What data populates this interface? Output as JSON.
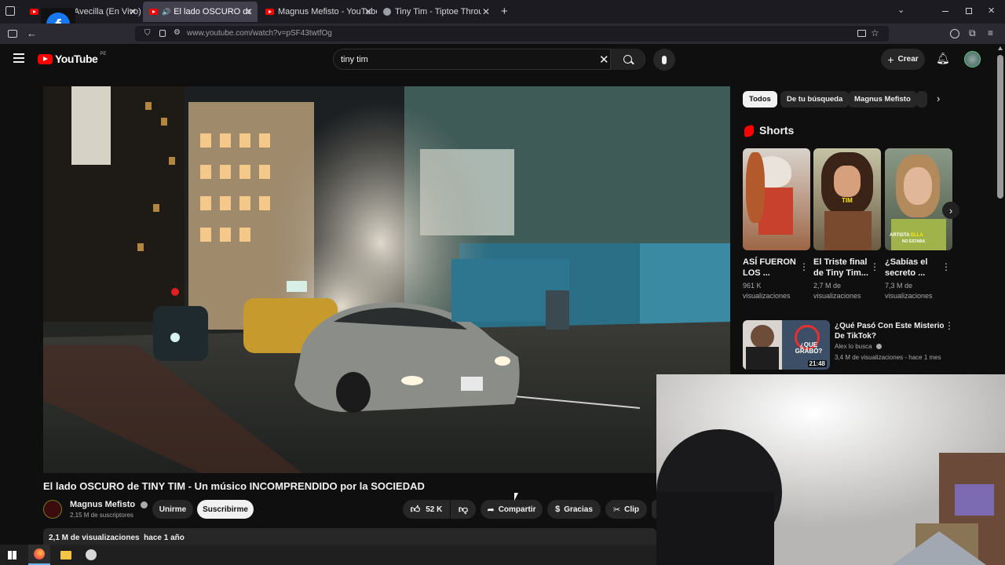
{
  "browser": {
    "tabs": [
      {
        "title": "Avecilla (En Vivo)"
      },
      {
        "title": "El lado OSCURO de TINY TIM"
      },
      {
        "title": "Magnus Mefisto - YouTube"
      },
      {
        "title": "Tiny Tim - Tiptoe Through the T"
      }
    ],
    "url": "www.youtube.com/watch?v=pSF43twtfOg"
  },
  "youtube": {
    "logo_text": "YouTube",
    "region": "PE",
    "search_value": "tiny tim",
    "create_label": "Crear"
  },
  "video": {
    "title": "El lado OSCURO de TINY TIM - Un músico INCOMPRENDIDO por la SOCIEDAD",
    "channel": "Magnus Mefisto",
    "subscribers": "2,15 M de suscriptores",
    "join_label": "Unirme",
    "subscribe_label": "Suscribirme",
    "likes": "52 K",
    "share_label": "Compartir",
    "thanks_label": "Gracias",
    "clip_label": "Clip",
    "views_date": "2,1 M de visualizaciones  hace 1 año"
  },
  "sidebar": {
    "chips": [
      {
        "label": "Todos"
      },
      {
        "label": "De tu búsqueda"
      },
      {
        "label": "Magnus Mefisto"
      }
    ],
    "shorts_heading": "Shorts",
    "shorts": [
      {
        "title": "ASÍ FUERON LOS ...",
        "views": "961 K visualizaciones"
      },
      {
        "title": "El Triste final de Tiny Tim...",
        "views": "2,7 M de visualizaciones"
      },
      {
        "title": "¿Sabías el secreto ...",
        "views": "7,3 M de visualizaciones"
      }
    ],
    "short_overlay_texts": {
      "tim": "TIM",
      "artista": "ARTISTA",
      "ella": "ELLA",
      "no_estaba": "NO ESTABA"
    },
    "recommended": {
      "title": "¿Qué Pasó Con Este Misterio De TikTok?",
      "channel": "Alex lo busca",
      "meta": "3,4 M de visualizaciones - hace 1 mes",
      "duration": "21:48",
      "thumb_text": "¿QUE GRABÓ?"
    }
  },
  "colors": {
    "accent": "#ff0000",
    "background": "#0f0f0f",
    "chip_bg": "#272727"
  }
}
